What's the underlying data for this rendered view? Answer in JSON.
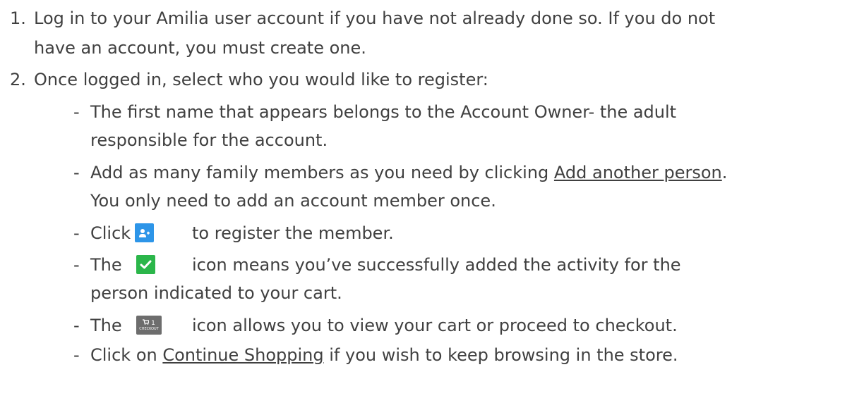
{
  "steps": [
    {
      "number": "1.",
      "line1": "Log in to your Amilia user account if you have not already done so. If you do not",
      "line2": "have an account,  you must create one."
    },
    {
      "number": "2.",
      "line1": "Once logged in, select who you would like to register:"
    }
  ],
  "bullets": {
    "marker": "-",
    "b1_line1": "The first name that appears belongs to the Account Owner- the adult",
    "b1_line2": "responsible for the account.",
    "b2_text_before": "Add as many family members as you need by clicking ",
    "b2_link": "Add another person",
    "b2_text_after": ".",
    "b2_line2": "You only need to add an account member once.",
    "b3_before": "Click",
    "b3_after": "to register the member.",
    "b4_before": "The",
    "b4_after": "icon means you’ve successfully added the activity for the",
    "b4_line2": "person indicated to your cart.",
    "b5_before": "The",
    "b5_after": "icon allows you to view your cart or proceed to checkout.",
    "b6_before": "Click on ",
    "b6_link": "Continue Shopping",
    "b6_after": " if you wish to keep browsing in the store."
  },
  "icons": {
    "add_person": "add-person-icon",
    "checkmark": "checkmark-icon",
    "cart_checkout": "cart-checkout-icon",
    "cart_count": "1",
    "cart_label": "CHECKOUT",
    "add_color": "#2d95e8",
    "check_color": "#2bb64a",
    "cart_color": "#6d6d6d"
  }
}
